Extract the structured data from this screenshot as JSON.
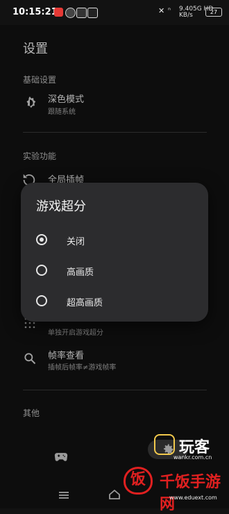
{
  "status_bar": {
    "time": "10:15:21",
    "network_speed": "9.40",
    "network_unit": "KB/s",
    "signal_left": "5G HD",
    "signal_right": "4G HD",
    "battery": "27"
  },
  "page": {
    "title": "设置",
    "sections": {
      "basic": {
        "title": "基础设置",
        "dark_mode": {
          "title": "深色模式",
          "subtitle": "跟随系统"
        }
      },
      "experimental": {
        "title": "实验功能",
        "global_frame": {
          "title": "全局插帧"
        },
        "game_upscale_row": {
          "subtitle": "单独开启游戏超分"
        },
        "frame_rate": {
          "title": "帧率查看",
          "subtitle": "插帧后帧率≠游戏帧率"
        }
      },
      "other": {
        "title": "其他"
      }
    }
  },
  "dialog": {
    "title": "游戏超分",
    "options": [
      {
        "label": "关闭",
        "checked": true
      },
      {
        "label": "高画质",
        "checked": false
      },
      {
        "label": "超高画质",
        "checked": false
      }
    ]
  },
  "watermark": {
    "brand_cn": "玩客",
    "brand_url": "wankr.com.cn",
    "brand2_cn": "千饭手游网",
    "brand2_url": "www.eduext.com",
    "bowl_char": "饭"
  },
  "icons": {
    "dark_mode": "brightness-gear-icon",
    "global_frame": "refresh-clock-icon",
    "upscale": "dot-grid-icon",
    "frame_rate": "search-icon",
    "tab_games": "gamepad-icon",
    "tab_settings": "gear-icon",
    "nav_menu": "menu-icon",
    "nav_home": "home-icon",
    "nav_back": "back-icon"
  }
}
